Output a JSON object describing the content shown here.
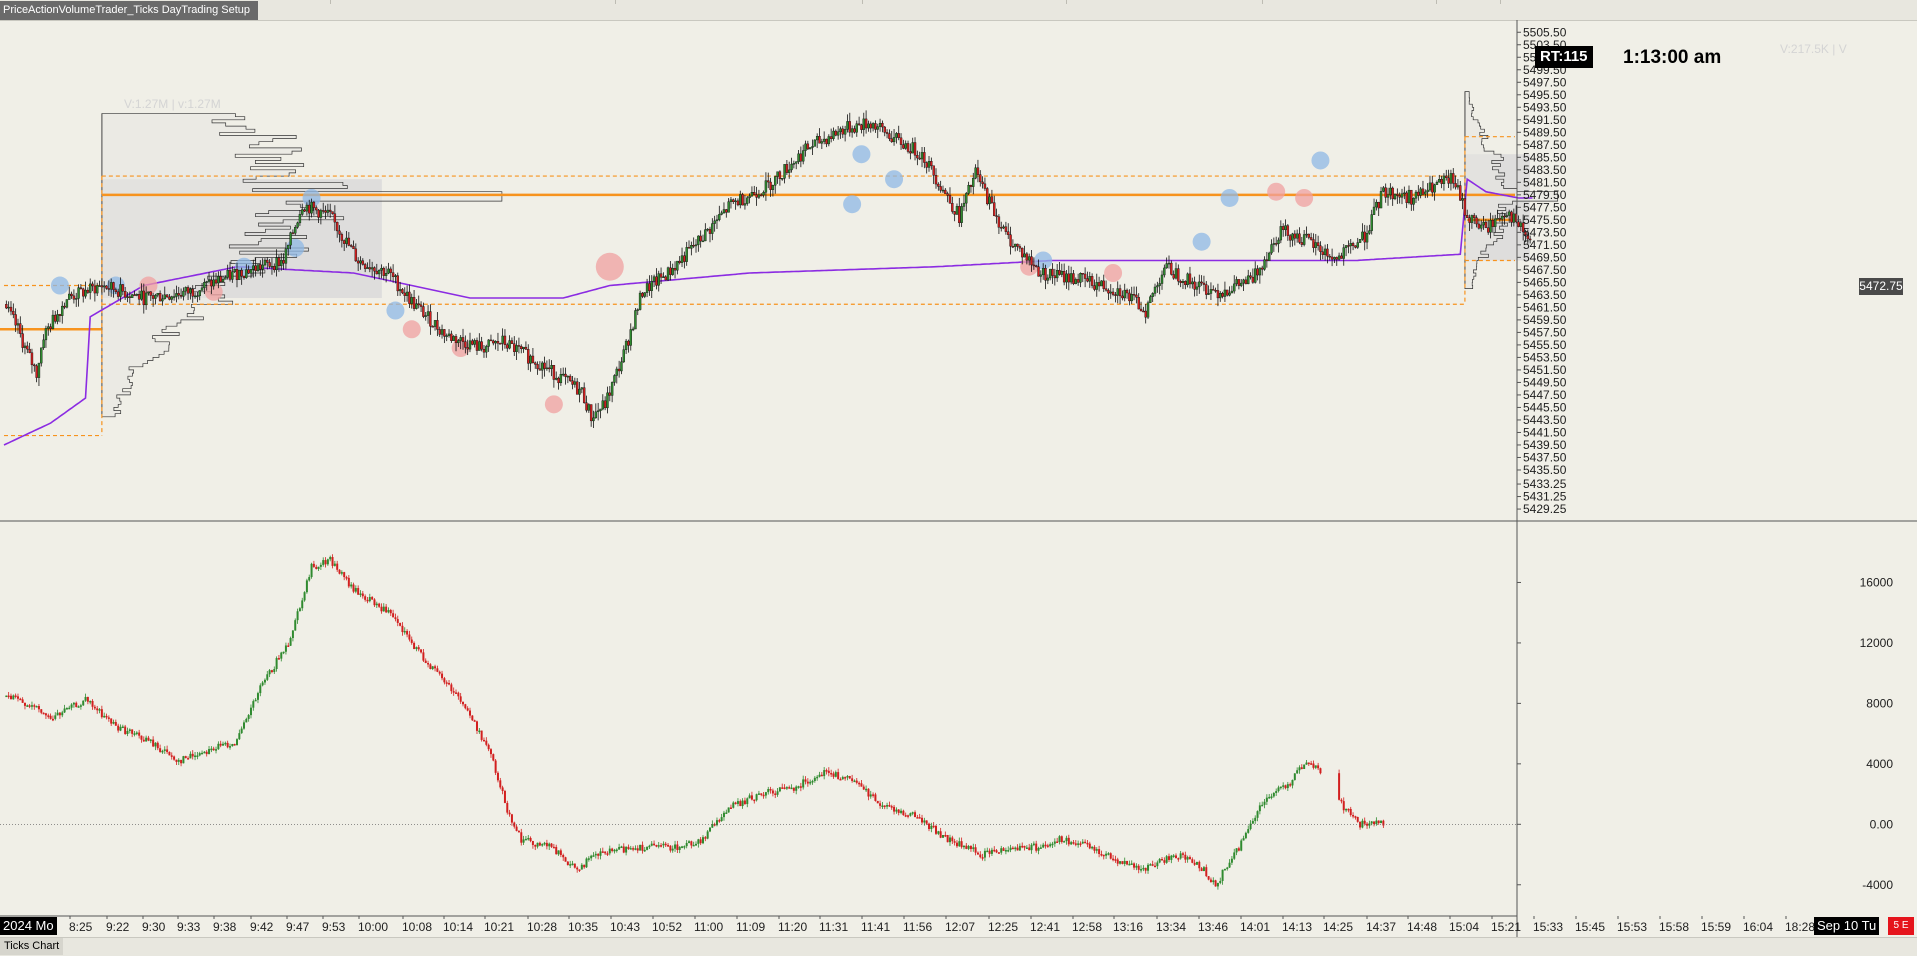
{
  "window": {
    "tab_title": "PriceActionVolumeTrader_Ticks DayTrading Setup",
    "bottom_tab": "Ticks Chart"
  },
  "overlay": {
    "rt_badge": "RT:115",
    "clock": "1:13:00 am",
    "last_price": "5472.75",
    "date_left": "2024 Mo",
    "date_right": "Sep 10  Tu",
    "status_badge": "5 E",
    "volume_left": "V:1.27M | v:1.27M",
    "volume_right": "V:217.5K | V"
  },
  "colors": {
    "background": "#f0efe7",
    "candle_up": "#2f8a2f",
    "candle_down": "#d21f1f",
    "vwap": "#8b2be2",
    "levels": "#f7931e",
    "profile_value_area": "#d2d1d5",
    "bubble_buy": "#8fb8e6",
    "bubble_sell": "#f0a0a0"
  },
  "chart_data": [
    {
      "type": "candlestick",
      "title": "",
      "ylim": [
        5427.5,
        5506.5
      ],
      "y_ticks": [
        5505.5,
        5503.5,
        5501.5,
        5499.5,
        5497.5,
        5495.5,
        5493.5,
        5491.5,
        5489.5,
        5487.5,
        5485.5,
        5483.5,
        5481.5,
        5479.5,
        5477.5,
        5475.5,
        5473.5,
        5471.5,
        5469.5,
        5467.5,
        5465.5,
        5463.5,
        5461.5,
        5459.5,
        5457.5,
        5455.5,
        5453.5,
        5451.5,
        5449.5,
        5447.5,
        5445.5,
        5443.5,
        5441.5,
        5439.5,
        5437.5,
        5435.5,
        5433.25,
        5431.25,
        5429.25
      ],
      "x_ticks": [
        "8:25",
        "9:22",
        "9:30",
        "9:33",
        "9:38",
        "9:42",
        "9:47",
        "9:53",
        "10:00",
        "10:08",
        "10:14",
        "10:21",
        "10:28",
        "10:35",
        "10:43",
        "10:52",
        "11:00",
        "11:09",
        "11:20",
        "11:31",
        "11:41",
        "11:56",
        "12:07",
        "12:25",
        "12:41",
        "12:58",
        "13:16",
        "13:34",
        "13:46",
        "14:01",
        "14:13",
        "14:25",
        "14:37",
        "14:48",
        "15:04",
        "15:21",
        "15:33",
        "15:45",
        "15:53",
        "15:58",
        "15:59",
        "16:04",
        "18:28"
      ],
      "anchors": [
        [
          0,
          5462
        ],
        [
          6,
          5458
        ],
        [
          9,
          5455
        ],
        [
          14,
          5451
        ],
        [
          17,
          5457
        ],
        [
          27,
          5463
        ],
        [
          42,
          5465
        ],
        [
          60,
          5463
        ],
        [
          80,
          5464
        ],
        [
          100,
          5467
        ],
        [
          120,
          5469
        ],
        [
          128,
          5478
        ],
        [
          140,
          5476
        ],
        [
          152,
          5469
        ],
        [
          165,
          5467
        ],
        [
          176,
          5462
        ],
        [
          190,
          5457
        ],
        [
          205,
          5455
        ],
        [
          214,
          5456
        ],
        [
          228,
          5453
        ],
        [
          240,
          5450
        ],
        [
          248,
          5448
        ],
        [
          252,
          5444
        ],
        [
          258,
          5446
        ],
        [
          266,
          5454
        ],
        [
          274,
          5464
        ],
        [
          285,
          5467
        ],
        [
          298,
          5472
        ],
        [
          312,
          5478
        ],
        [
          328,
          5481
        ],
        [
          345,
          5487
        ],
        [
          360,
          5490
        ],
        [
          372,
          5491
        ],
        [
          384,
          5488
        ],
        [
          394,
          5486
        ],
        [
          402,
          5481
        ],
        [
          410,
          5476
        ],
        [
          417,
          5483
        ],
        [
          430,
          5473
        ],
        [
          445,
          5467
        ],
        [
          462,
          5466
        ],
        [
          480,
          5464
        ],
        [
          490,
          5461
        ],
        [
          498,
          5468
        ],
        [
          512,
          5465
        ],
        [
          522,
          5464
        ],
        [
          536,
          5466
        ],
        [
          548,
          5474
        ],
        [
          560,
          5472
        ],
        [
          572,
          5469
        ],
        [
          584,
          5473
        ],
        [
          592,
          5480
        ],
        [
          605,
          5479
        ],
        [
          615,
          5481
        ],
        [
          622,
          5482
        ],
        [
          628,
          5476
        ],
        [
          636,
          5474
        ],
        [
          645,
          5477
        ],
        [
          655,
          5472
        ]
      ],
      "vwap": [
        [
          0,
          5439.5
        ],
        [
          20,
          5443
        ],
        [
          35,
          5447
        ],
        [
          37,
          5460
        ],
        [
          60,
          5465
        ],
        [
          100,
          5468
        ],
        [
          150,
          5467
        ],
        [
          200,
          5463
        ],
        [
          240,
          5463
        ],
        [
          260,
          5465
        ],
        [
          320,
          5467
        ],
        [
          400,
          5468
        ],
        [
          450,
          5469
        ],
        [
          520,
          5469
        ],
        [
          580,
          5469
        ],
        [
          625,
          5470
        ],
        [
          628,
          5482
        ],
        [
          636,
          5480
        ],
        [
          650,
          5479
        ]
      ],
      "profile_left": {
        "price_range": [
          5444.5,
          5492.5
        ],
        "value_area": [
          5463,
          5482
        ],
        "poc": 5479.5
      },
      "profile_right": {
        "price_range": [
          5465,
          5496
        ],
        "value_area": [
          5469,
          5486
        ],
        "poc": 5479.5
      },
      "levels": {
        "solid": [
          5479.5,
          5475.5
        ],
        "dashed": [
          5482.5,
          5462.0,
          5465.0,
          5441.0,
          5488.8,
          5469.0
        ],
        "left_marker": 5458.0
      },
      "bubbles": [
        [
          24,
          5465,
          "buy"
        ],
        [
          48,
          5465,
          "buy"
        ],
        [
          62,
          5465,
          "sell"
        ],
        [
          90,
          5464,
          "sell"
        ],
        [
          103,
          5468,
          "buy"
        ],
        [
          125,
          5471,
          "buy"
        ],
        [
          132,
          5479,
          "buy"
        ],
        [
          168,
          5461,
          "buy"
        ],
        [
          175,
          5458,
          "sell"
        ],
        [
          196,
          5455,
          "sell"
        ],
        [
          236,
          5446,
          "sell"
        ],
        [
          260,
          5468,
          "sell"
        ],
        [
          364,
          5478,
          "buy"
        ],
        [
          368,
          5486,
          "buy"
        ],
        [
          382,
          5482,
          "buy"
        ],
        [
          440,
          5468,
          "sell"
        ],
        [
          446,
          5469,
          "buy"
        ],
        [
          476,
          5467,
          "sell"
        ],
        [
          514,
          5472,
          "buy"
        ],
        [
          526,
          5479,
          "buy"
        ],
        [
          546,
          5480,
          "sell"
        ],
        [
          558,
          5479,
          "sell"
        ],
        [
          565,
          5485,
          "buy"
        ]
      ]
    },
    {
      "type": "candlestick",
      "title": "",
      "ylim": [
        -6000,
        20000
      ],
      "y_ticks": [
        16000,
        12000,
        8000,
        4000,
        0,
        -4000
      ],
      "anchors": [
        [
          0,
          8500
        ],
        [
          10,
          8000
        ],
        [
          20,
          7000
        ],
        [
          35,
          8200
        ],
        [
          48,
          6500
        ],
        [
          62,
          5500
        ],
        [
          75,
          4200
        ],
        [
          85,
          4800
        ],
        [
          100,
          5500
        ],
        [
          110,
          9000
        ],
        [
          122,
          12000
        ],
        [
          132,
          17000
        ],
        [
          140,
          17500
        ],
        [
          150,
          15500
        ],
        [
          165,
          14000
        ],
        [
          180,
          11000
        ],
        [
          195,
          8500
        ],
        [
          208,
          5000
        ],
        [
          216,
          1000
        ],
        [
          222,
          -1000
        ],
        [
          235,
          -1500
        ],
        [
          245,
          -3000
        ],
        [
          255,
          -2000
        ],
        [
          270,
          -1500
        ],
        [
          290,
          -1500
        ],
        [
          300,
          -1000
        ],
        [
          310,
          1000
        ],
        [
          325,
          2000
        ],
        [
          340,
          2500
        ],
        [
          352,
          3500
        ],
        [
          365,
          2800
        ],
        [
          378,
          1200
        ],
        [
          392,
          500
        ],
        [
          405,
          -1000
        ],
        [
          420,
          -2000
        ],
        [
          432,
          -1500
        ],
        [
          445,
          -1500
        ],
        [
          452,
          -1000
        ],
        [
          466,
          -1500
        ],
        [
          480,
          -2500
        ],
        [
          490,
          -3000
        ],
        [
          502,
          -2000
        ],
        [
          512,
          -2500
        ],
        [
          520,
          -4000
        ],
        [
          530,
          -1500
        ],
        [
          540,
          1500
        ],
        [
          552,
          2800
        ],
        [
          558,
          4000
        ],
        [
          566,
          3500
        ],
        [
          573,
          1500
        ],
        [
          582,
          0
        ],
        [
          592,
          0
        ]
      ]
    }
  ]
}
